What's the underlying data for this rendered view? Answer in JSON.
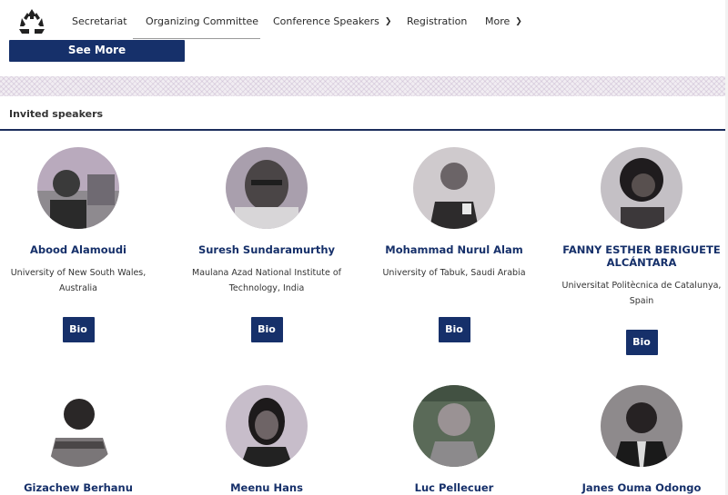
{
  "nav": {
    "items": [
      {
        "label": "Secretariat"
      },
      {
        "label": "Organizing Committee"
      },
      {
        "label": "Conference Speakers"
      },
      {
        "label": "Registration"
      },
      {
        "label": "More"
      }
    ]
  },
  "see_more_label": "See More",
  "section_title": "Invited speakers",
  "bio_label": "Bio",
  "speakers": [
    {
      "name": "Abood Alamoudi",
      "affiliation": "University of New South Wales, Australia"
    },
    {
      "name": "Suresh Sundaramurthy",
      "affiliation": "Maulana Azad National Institute of Technology, India"
    },
    {
      "name": "Mohammad Nurul Alam",
      "affiliation": "University of Tabuk, Saudi Arabia"
    },
    {
      "name": "FANNY ESTHER BERIGUETE ALCÁNTARA",
      "affiliation": "Universitat Politècnica de Catalunya, Spain"
    },
    {
      "name": "Gizachew Berhanu",
      "affiliation": ""
    },
    {
      "name": "Meenu Hans",
      "affiliation": ""
    },
    {
      "name": "Luc Pellecuer",
      "affiliation": ""
    },
    {
      "name": "Janes Ouma Odongo",
      "affiliation": ""
    }
  ]
}
